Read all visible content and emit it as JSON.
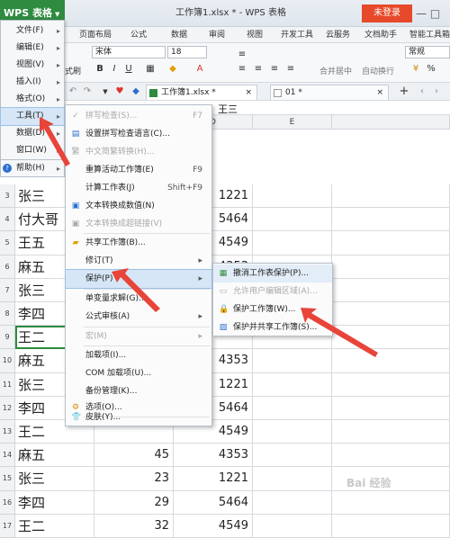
{
  "app": {
    "name": "WPS 表格",
    "doc_title": "工作簿1.xlsx * - WPS 表格",
    "login": "未登录"
  },
  "ribbon_tabs": [
    "页面布局",
    "公式",
    "数据",
    "审阅",
    "视图",
    "开发工具",
    "云服务",
    "文档助手",
    "智能工具箱"
  ],
  "ribbon": {
    "font_name": "宋体",
    "font_size": "18",
    "number_format": "常规",
    "merge_label": "合并居中",
    "wrap_label": "自动换行",
    "format_painter": "式刷"
  },
  "doc_tabs": [
    "工作簿1.xlsx *",
    "01 *"
  ],
  "formula_bar": {
    "value": "王三"
  },
  "columns": [
    "C",
    "D",
    "E"
  ],
  "rows": [
    {
      "num": "3",
      "name": "张三",
      "b": "",
      "c": "1221"
    },
    {
      "num": "4",
      "name": "付大哥",
      "b": "",
      "c": "5464"
    },
    {
      "num": "5",
      "name": "王五",
      "b": "",
      "c": "4549"
    },
    {
      "num": "6",
      "name": "麻五",
      "b": "",
      "c": "4353"
    },
    {
      "num": "7",
      "name": "张三",
      "b": "",
      "c": ""
    },
    {
      "num": "8",
      "name": "李四",
      "b": "",
      "c": ""
    },
    {
      "num": "9",
      "name": "王二",
      "b": "",
      "c": ""
    },
    {
      "num": "10",
      "name": "麻五",
      "b": "",
      "c": "4353"
    },
    {
      "num": "11",
      "name": "张三",
      "b": "",
      "c": "1221"
    },
    {
      "num": "12",
      "name": "李四",
      "b": "",
      "c": "5464"
    },
    {
      "num": "13",
      "name": "王二",
      "b": "",
      "c": "4549"
    },
    {
      "num": "14",
      "name": "麻五",
      "b": "45",
      "c": "4353"
    },
    {
      "num": "15",
      "name": "张三",
      "b": "23",
      "c": "1221"
    },
    {
      "num": "16",
      "name": "李四",
      "b": "29",
      "c": "5464"
    },
    {
      "num": "17",
      "name": "王二",
      "b": "32",
      "c": "4549"
    }
  ],
  "main_menu": [
    {
      "label": "文件(F)"
    },
    {
      "label": "编辑(E)"
    },
    {
      "label": "视图(V)"
    },
    {
      "label": "插入(I)"
    },
    {
      "label": "格式(O)"
    },
    {
      "label": "工具(T)"
    },
    {
      "label": "数据(D)"
    },
    {
      "label": "窗口(W)"
    },
    {
      "label": "帮助(H)"
    }
  ],
  "tools_menu": [
    {
      "label": "拼写检查(S)...",
      "shortcut": "F7"
    },
    {
      "label": "设置拼写检查语言(C)...",
      "shortcut": ""
    },
    {
      "label": "中文简繁转换(H)...",
      "shortcut": ""
    },
    {
      "label": "重算活动工作簿(E)",
      "shortcut": "F9"
    },
    {
      "label": "计算工作表(J)",
      "shortcut": "Shift+F9"
    },
    {
      "label": "文本转换成数值(N)",
      "shortcut": ""
    },
    {
      "label": "文本转换成超链接(V)",
      "shortcut": ""
    },
    {
      "label": "共享工作簿(B)...",
      "shortcut": ""
    },
    {
      "label": "修订(T)",
      "shortcut": ""
    },
    {
      "label": "保护(P)",
      "shortcut": ""
    },
    {
      "label": "单变量求解(G)...",
      "shortcut": ""
    },
    {
      "label": "公式审核(A)",
      "shortcut": ""
    },
    {
      "label": "宏(M)",
      "shortcut": ""
    },
    {
      "label": "加载项(I)...",
      "shortcut": ""
    },
    {
      "label": "COM 加载项(U)...",
      "shortcut": ""
    },
    {
      "label": "备份管理(K)...",
      "shortcut": ""
    },
    {
      "label": "选项(O)...",
      "shortcut": ""
    },
    {
      "label": "皮肤(Y)...",
      "shortcut": ""
    }
  ],
  "protect_menu": [
    {
      "label": "撤消工作表保护(P)..."
    },
    {
      "label": "允许用户编辑区域(A)..."
    },
    {
      "label": "保护工作簿(W)..."
    },
    {
      "label": "保护并共享工作簿(S)..."
    }
  ],
  "watermark": "Bai 经验",
  "colors": {
    "accent": "#2e8b3f",
    "login": "#e64a2a",
    "arrow": "#e8443a",
    "highlight": "#d6e6f6"
  }
}
